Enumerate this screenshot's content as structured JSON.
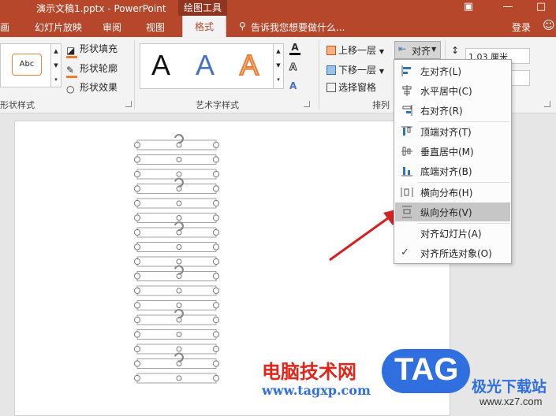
{
  "window": {
    "title": "演示文稿1.pptx - PowerPoint",
    "context_tab": "绘图工具",
    "signin": "登录"
  },
  "tabs": [
    "画",
    "幻灯片放映",
    "审阅",
    "视图",
    "格式"
  ],
  "active_tab": "格式",
  "tell_me": "告诉我您想要做什么...",
  "ribbon": {
    "shape_styles": {
      "preview": "Abc",
      "fill": "形状填充",
      "outline": "形状轮廓",
      "effects": "形状效果",
      "group_label": "形状样式"
    },
    "wordart": {
      "samples": [
        "A",
        "A",
        "A"
      ],
      "group_label": "艺术字样式"
    },
    "arrange": {
      "bring_forward": "上移一层",
      "send_backward": "下移一层",
      "selection_pane": "选择窗格",
      "align": "对齐",
      "group_label": "排列"
    },
    "size": {
      "height": "1.03 厘米"
    }
  },
  "align_menu": {
    "items": [
      {
        "label": "左对齐(L)",
        "icon": "align-left-icon"
      },
      {
        "label": "水平居中(C)",
        "icon": "align-center-icon"
      },
      {
        "label": "右对齐(R)",
        "icon": "align-right-icon"
      },
      {
        "label": "顶端对齐(T)",
        "icon": "align-top-icon"
      },
      {
        "label": "垂直居中(M)",
        "icon": "align-middle-icon"
      },
      {
        "label": "底端对齐(B)",
        "icon": "align-bottom-icon"
      },
      {
        "label": "横向分布(H)",
        "icon": "distribute-horizontal-icon"
      },
      {
        "label": "纵向分布(V)",
        "icon": "distribute-vertical-icon"
      },
      {
        "label": "对齐幻灯片(A)",
        "icon": ""
      },
      {
        "label": "对齐所选对象(O)",
        "icon": "checkmark-icon"
      }
    ],
    "highlighted": "纵向分布(V)",
    "checked": "对齐所选对象(O)"
  },
  "watermark": {
    "site_name": "电脑技术网",
    "url": "www.tagxp.com",
    "tag": "TAG",
    "site2": "极光下载站",
    "url2": "www.xz7.com"
  },
  "colors": {
    "accent": "#b7472a",
    "menu_highlight": "#c6c6c6",
    "arrow": "#d42020",
    "watermark_red": "#e0261a",
    "watermark_blue": "#2f6fe0"
  }
}
